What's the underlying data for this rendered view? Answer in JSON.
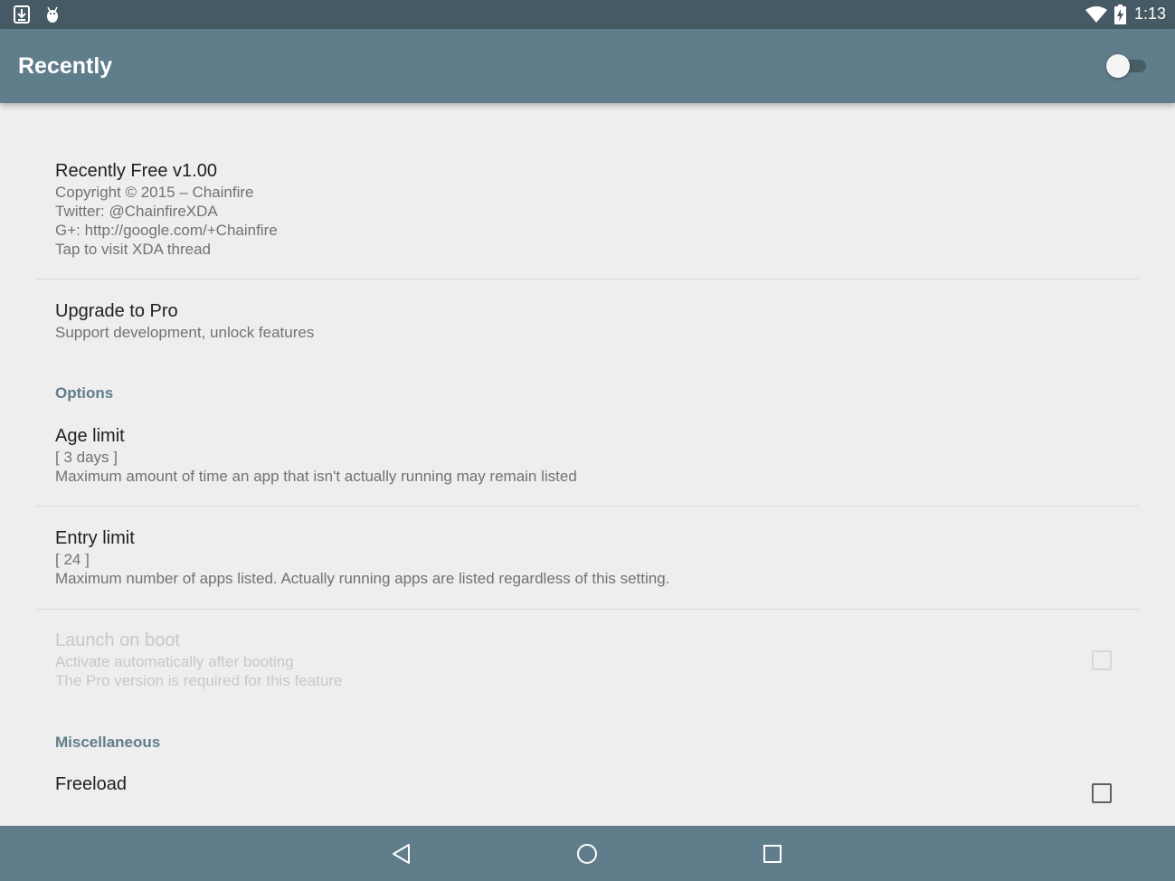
{
  "status_bar": {
    "time": "1:13",
    "left_icons": [
      "download-icon",
      "android-debug-icon"
    ],
    "right_icons": [
      "wifi-icon",
      "battery-charging-icon"
    ]
  },
  "app_bar": {
    "title": "Recently",
    "master_switch_on": false
  },
  "about": {
    "title": "Recently Free v1.00",
    "lines": [
      "Copyright © 2015 – Chainfire",
      "Twitter: @ChainfireXDA",
      "G+: http://google.com/+Chainfire",
      "Tap to visit XDA thread"
    ]
  },
  "upgrade": {
    "title": "Upgrade to Pro",
    "summary": "Support development, unlock features"
  },
  "options": {
    "header": "Options",
    "age_limit": {
      "title": "Age limit",
      "value": "[ 3 days ]",
      "summary": "Maximum amount of time an app that isn't actually running may remain listed"
    },
    "entry_limit": {
      "title": "Entry limit",
      "value": "[ 24 ]",
      "summary": "Maximum number of apps listed. Actually running apps are listed regardless of this setting."
    },
    "launch_on_boot": {
      "title": "Launch on boot",
      "summary": "Activate automatically after booting",
      "note": "The Pro version is required for this feature",
      "checked": false,
      "enabled": false
    }
  },
  "misc": {
    "header": "Miscellaneous",
    "freeload": {
      "title": "Freeload",
      "checked": false
    }
  },
  "nav_bar": {
    "buttons": [
      "back-icon",
      "home-icon",
      "recents-icon"
    ]
  },
  "colors": {
    "status_bar": "#455a64",
    "app_bar": "#607d8b",
    "accent": "#607d8b",
    "background": "#eeeeee"
  }
}
